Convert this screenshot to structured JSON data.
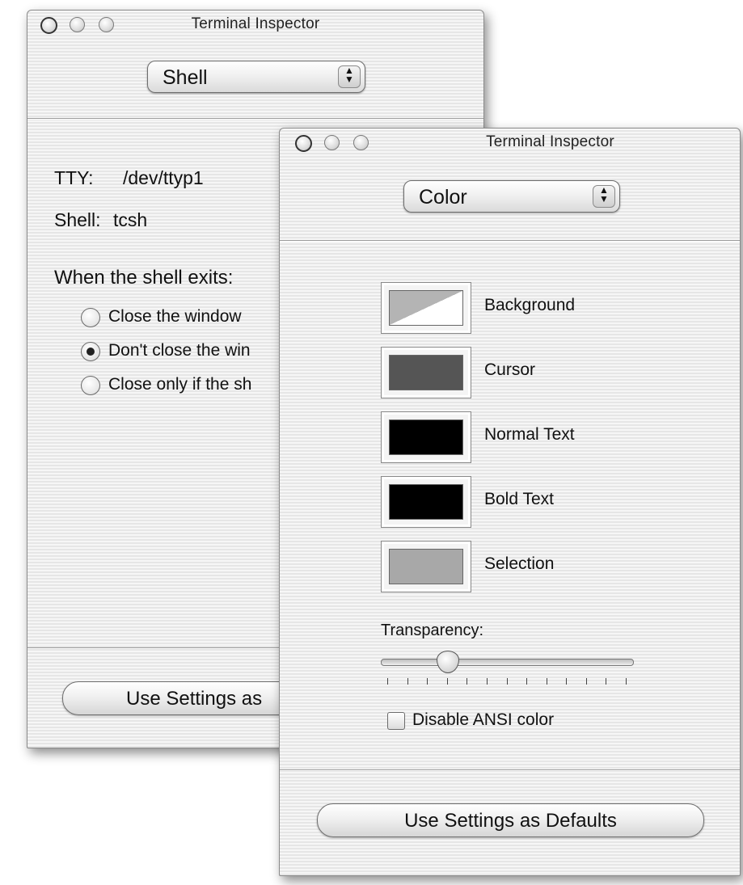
{
  "back_window": {
    "title": "Terminal Inspector",
    "popup_selected": "Shell",
    "tty_label": "TTY:",
    "tty_value": "/dev/ttyp1",
    "shell_label": "Shell:",
    "shell_value": "tcsh",
    "exit_heading": "When the shell exits:",
    "radio_options": [
      {
        "label": "Close the window",
        "selected": false
      },
      {
        "label": "Don't close the win",
        "selected": true
      },
      {
        "label": "Close only if the sh",
        "selected": false
      }
    ],
    "defaults_button": "Use Settings as"
  },
  "front_window": {
    "title": "Terminal Inspector",
    "popup_selected": "Color",
    "swatches": [
      {
        "label": "Background",
        "color": "#ffffff",
        "second_color": "#b4b4b4"
      },
      {
        "label": "Cursor",
        "color": "#555555"
      },
      {
        "label": "Normal Text",
        "color": "#000000"
      },
      {
        "label": "Bold Text",
        "color": "#000000"
      },
      {
        "label": "Selection",
        "color": "#a8a8a8"
      }
    ],
    "transparency_label": "Transparency:",
    "transparency_value": 0.25,
    "slider_ticks": 13,
    "disable_ansi_label": "Disable ANSI color",
    "disable_ansi_checked": false,
    "defaults_button": "Use Settings as Defaults"
  }
}
